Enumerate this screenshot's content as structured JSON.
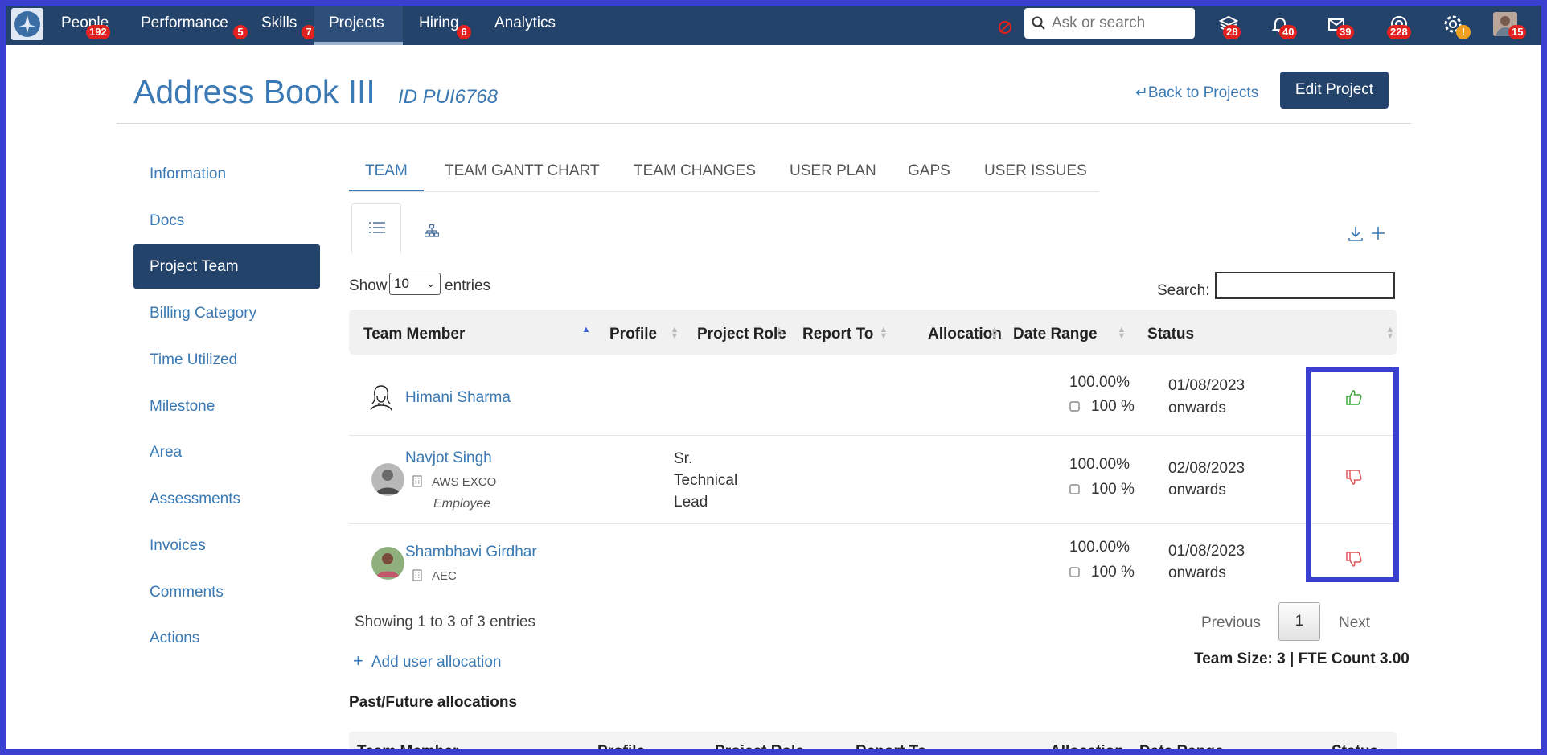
{
  "nav": {
    "items": [
      {
        "label": "People",
        "badge": "192"
      },
      {
        "label": "Performance",
        "badge": "5"
      },
      {
        "label": "Skills",
        "badge": "7"
      },
      {
        "label": "Projects",
        "badge": ""
      },
      {
        "label": "Hiring",
        "badge": "6"
      },
      {
        "label": "Analytics",
        "badge": ""
      }
    ],
    "active": "Projects",
    "search_placeholder": "Ask or search",
    "icon_badges": {
      "layers": "28",
      "bell": "40",
      "mail": "39",
      "support": "228",
      "settings": "!",
      "profile": "15"
    }
  },
  "header": {
    "title": "Address Book III",
    "project_id": "ID PUI6768",
    "back_label": "Back to Projects",
    "edit_label": "Edit Project"
  },
  "sidebar": {
    "items": [
      "Information",
      "Docs",
      "Project Team",
      "Billing Category",
      "Time Utilized",
      "Milestone",
      "Area",
      "Assessments",
      "Invoices",
      "Comments",
      "Actions"
    ],
    "active": "Project Team"
  },
  "tabs": [
    "TEAM",
    "TEAM GANTT CHART",
    "TEAM CHANGES",
    "USER PLAN",
    "GAPS",
    "USER ISSUES"
  ],
  "table_controls": {
    "show_label": "Show",
    "entries_value": "10",
    "entries_label": "entries",
    "search_label": "Search:"
  },
  "table": {
    "columns": [
      "Team Member",
      "Profile",
      "Project Role",
      "Report To",
      "Allocation",
      "Date Range",
      "Status"
    ],
    "rows": [
      {
        "name": "Himani Sharma",
        "company": "",
        "type": "",
        "profile": [],
        "allocation": "100.00%",
        "allocation_pct": "100 %",
        "date": "01/08/2023",
        "date_suffix": "onwards",
        "status": "approved"
      },
      {
        "name": "Navjot Singh",
        "company": "AWS EXCO",
        "type": "Employee",
        "profile": [
          "Sr.",
          "Technical",
          "Lead"
        ],
        "allocation": "100.00%",
        "allocation_pct": "100 %",
        "date": "02/08/2023",
        "date_suffix": "onwards",
        "status": "rejected"
      },
      {
        "name": "Shambhavi Girdhar",
        "company": "AEC",
        "type": "",
        "profile": [],
        "allocation": "100.00%",
        "allocation_pct": "100 %",
        "date": "01/08/2023",
        "date_suffix": "onwards",
        "status": "rejected"
      }
    ]
  },
  "footer": {
    "info": "Showing 1 to 3 of 3 entries",
    "previous": "Previous",
    "page": "1",
    "next": "Next",
    "add_allocation": "Add user allocation",
    "team_size": "Team Size: 3 | FTE Count 3.00"
  },
  "past": {
    "heading": "Past/Future allocations",
    "columns": [
      "Team Member",
      "Profile",
      "Project Role",
      "Report To",
      "Allocation",
      "Date Range",
      "Status"
    ]
  },
  "colors": {
    "nav_bg": "#24436b",
    "link": "#3a79b3",
    "badge": "#e2201d",
    "approve": "#3aa63a",
    "reject": "#e0575a",
    "highlight": "#3b3fd0"
  }
}
